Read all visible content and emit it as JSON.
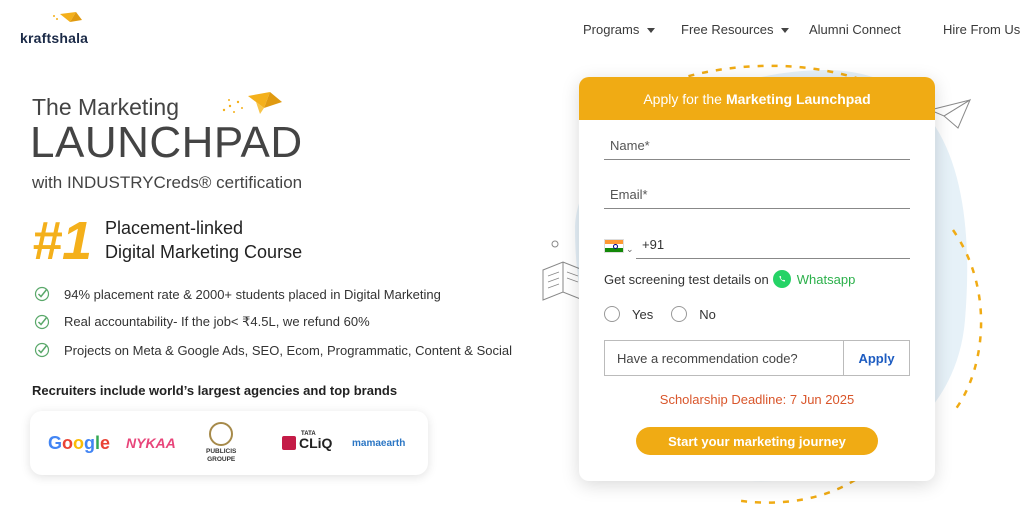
{
  "header": {
    "logo_text": "kraftshala",
    "nav": [
      {
        "label": "Programs",
        "has_dropdown": true
      },
      {
        "label": "Free Resources",
        "has_dropdown": true
      },
      {
        "label": "Alumni Connect",
        "has_dropdown": false
      },
      {
        "label": "Hire From Us",
        "has_dropdown": false
      }
    ]
  },
  "hero": {
    "subtitle": "The Marketing",
    "title": "LAUNCHPAD",
    "certification": "with INDUSTRYCreds® certification",
    "rank": "#1",
    "rank_line1": "Placement-linked",
    "rank_line2": "Digital Marketing Course",
    "bullets": [
      "94% placement rate & 2000+ students placed in Digital Marketing",
      "Real accountability- If the job< ₹4.5L, we refund 60%",
      "Projects on Meta & Google Ads, SEO, Ecom, Programmatic, Content & Social"
    ],
    "recruiters_heading": "Recruiters include world’s largest agencies and top brands",
    "brands": {
      "google": "Google",
      "nykaa": "NYKAA",
      "publicis_line1": "PUBLICIS",
      "publicis_line2": "GROUPE",
      "tata_small": "TATA",
      "tata": "CLiQ",
      "mamaearth": "mamaearth"
    }
  },
  "form": {
    "header_prefix": "Apply for the",
    "header_strong": "Marketing Launchpad",
    "name_placeholder": "Name*",
    "email_placeholder": "Email*",
    "phone_value": "+91",
    "whatsapp_prompt": "Get screening test details on",
    "whatsapp_label": "Whatsapp",
    "yes_label": "Yes",
    "no_label": "No",
    "recommendation_placeholder": "Have a recommendation code?",
    "apply_label": "Apply",
    "deadline": "Scholarship Deadline: 7 Jun 2025",
    "cta_label": "Start your marketing journey"
  },
  "colors": {
    "accent": "#f0ab14",
    "deadline": "#d9562b",
    "whatsapp": "#25d366",
    "link": "#1d5cc1"
  }
}
